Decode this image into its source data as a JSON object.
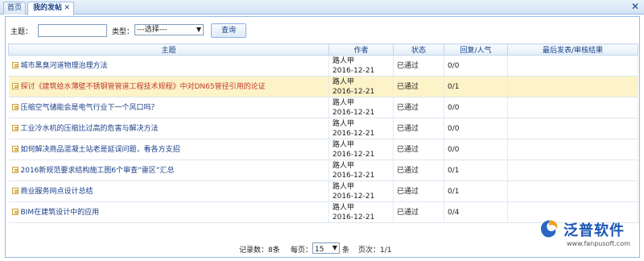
{
  "tabs": {
    "home": "首页",
    "active": "我的发帖",
    "active_close": "✕"
  },
  "search": {
    "subject_label": "主题：",
    "subject_value": "",
    "type_label": "类型：",
    "type_selected": "---选择---",
    "query_button": "查询"
  },
  "table": {
    "headers": [
      "主题",
      "作者",
      "状态",
      "回复/人气",
      "最后发表/审核结果"
    ],
    "rows": [
      {
        "subject": "城市黑臭河道物理治理方法",
        "author": "路人甲",
        "date": "2016-12-21",
        "status": "已通过",
        "replies": "0/0",
        "last": ""
      },
      {
        "subject": "探讨《建筑给水薄壁不锈钢管管道工程技术规程》中对DN65管径引用的论证",
        "author": "路人甲",
        "date": "2016-12-21",
        "status": "已通过",
        "replies": "0/1",
        "last": ""
      },
      {
        "subject": "压缩空气储能会是电气行业下一个风口吗？",
        "author": "路人甲",
        "date": "2016-12-21",
        "status": "已通过",
        "replies": "0/0",
        "last": ""
      },
      {
        "subject": "工业冷水机的压缩比过高的危害与解决方法",
        "author": "路人甲",
        "date": "2016-12-21",
        "status": "已通过",
        "replies": "0/0",
        "last": ""
      },
      {
        "subject": "如何解决商品混凝土站老是延误问题，看各方支招",
        "author": "路人甲",
        "date": "2016-12-21",
        "status": "已通过",
        "replies": "0/0",
        "last": ""
      },
      {
        "subject": "2016新规范要求结构施工图6个审查“雷区”汇总",
        "author": "路人甲",
        "date": "2016-12-21",
        "status": "已通过",
        "replies": "0/1",
        "last": ""
      },
      {
        "subject": "商业服务网点设计总结",
        "author": "路人甲",
        "date": "2016-12-21",
        "status": "已通过",
        "replies": "0/1",
        "last": ""
      },
      {
        "subject": "BIM在建筑设计中的应用",
        "author": "路人甲",
        "date": "2016-12-21",
        "status": "已通过",
        "replies": "0/4",
        "last": ""
      }
    ]
  },
  "footer": {
    "records": "记录数：8条",
    "per_page_label": "每页：",
    "per_page_value": "15",
    "per_page_unit": "条",
    "page_info": "页次：1/1"
  },
  "logo": {
    "name": "泛普软件",
    "url": "www.fanpusoft.com"
  },
  "colors": {
    "highlight_row": "#fdf3c8",
    "header_blue": "#15428b",
    "logo_blue": "#1a56b4"
  }
}
